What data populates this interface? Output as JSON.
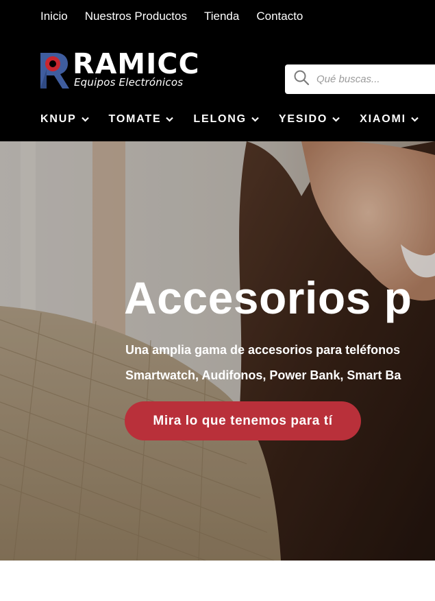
{
  "top_nav": [
    "Inicio",
    "Nuestros Productos",
    "Tienda",
    "Contacto"
  ],
  "logo": {
    "name": "RAMICC",
    "tagline": "Equipos Electrónicos"
  },
  "search": {
    "placeholder": "Qué buscas..."
  },
  "main_nav": [
    "KNUP",
    "TOMATE",
    "LELONG",
    "YESIDO",
    "XIAOMI"
  ],
  "hero": {
    "title": "Accesorios p",
    "subtitle_line1": "Una amplia gama de accesorios para teléfonos",
    "subtitle_line2": "Smartwatch,  Audifonos, Power Bank, Smart Ba",
    "button": "Mira lo que tenemos para tí"
  },
  "colors": {
    "header_bg": "#000000",
    "accent": "#b9303a",
    "logo_blue": "#3f5d9e",
    "logo_red": "#c8262f"
  },
  "icons": {
    "search": "search-icon",
    "dropdown": "chevron-down-icon"
  }
}
